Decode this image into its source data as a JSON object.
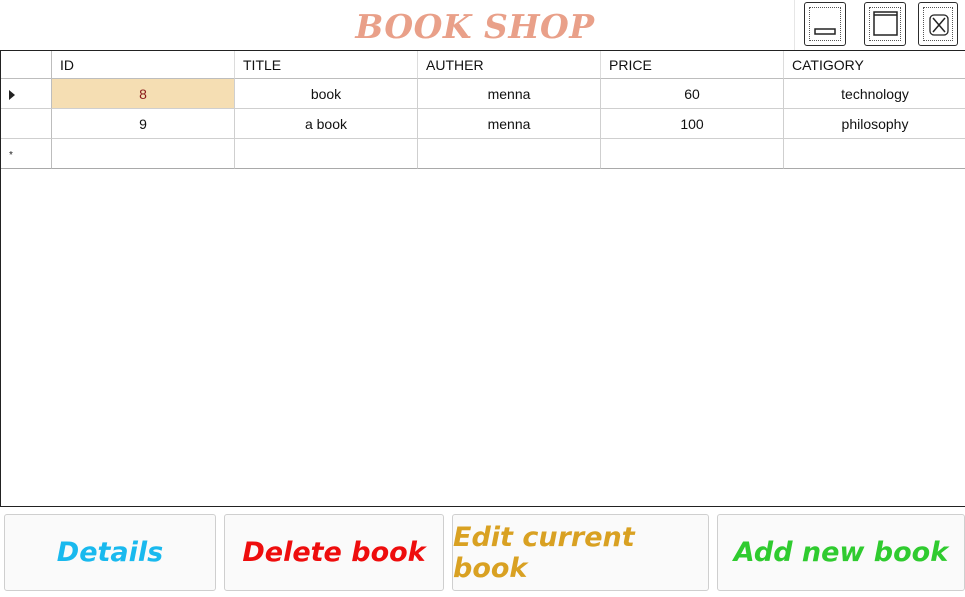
{
  "app": {
    "title": "BOOK SHOP"
  },
  "window_controls": {
    "minimize_icon": "minimize-icon",
    "maximize_icon": "maximize-icon",
    "close_icon": "close-icon"
  },
  "table": {
    "columns": [
      "ID",
      "TITLE",
      "AUTHER",
      "PRICE",
      "CATIGORY"
    ],
    "rows": [
      {
        "id": "8",
        "title": "book",
        "auther": "menna",
        "price": "60",
        "category": "technology"
      },
      {
        "id": "9",
        "title": "a book",
        "auther": "menna",
        "price": "100",
        "category": "philosophy"
      }
    ],
    "current_row_marker": "row-pointer-icon",
    "new_row_marker": "*"
  },
  "actions": {
    "details_label": "Details",
    "delete_label": "Delete book",
    "edit_label": "Edit current book",
    "add_label": "Add new book"
  },
  "colors": {
    "title": "#e9a089",
    "details": "#19b9ee",
    "delete": "#ee0d0d",
    "edit": "#d9a122",
    "add": "#2fcb2f",
    "selected_cell_bg": "#f5deb3",
    "selected_cell_text": "#8b1a1a"
  }
}
